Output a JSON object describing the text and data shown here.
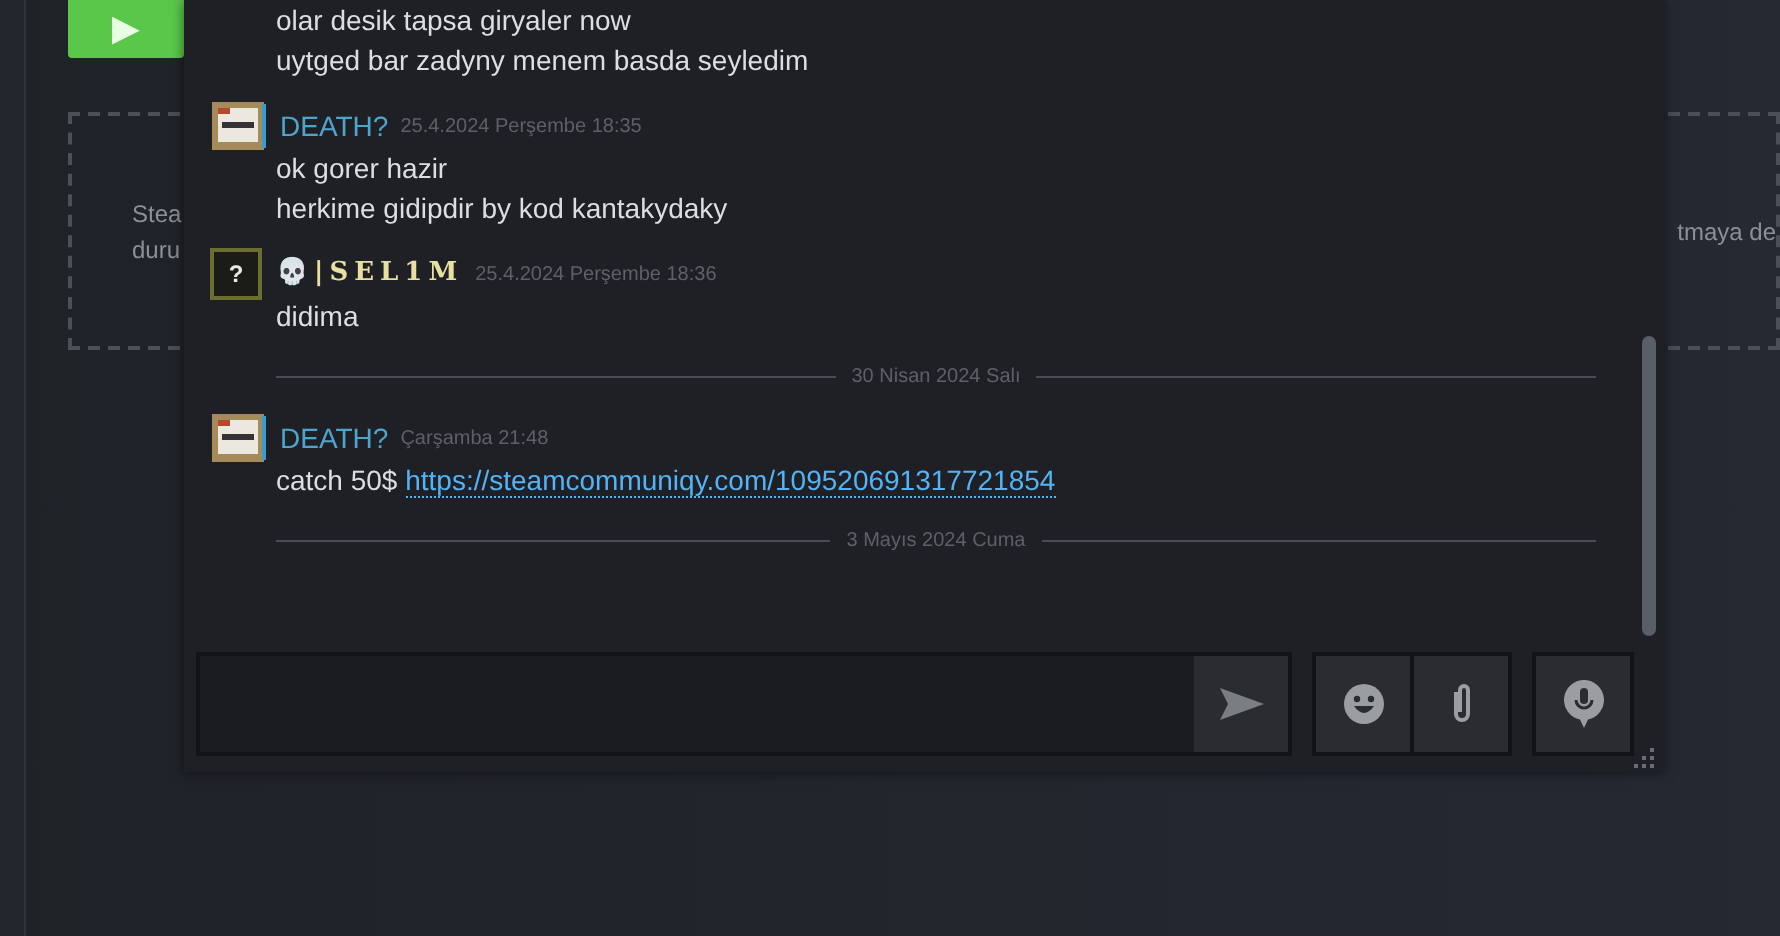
{
  "background": {
    "play_button": {
      "label": "▶"
    },
    "notice": {
      "left_lines": [
        "Stea",
        "duru"
      ],
      "right_fragment": "tmaya de"
    }
  },
  "chat": {
    "items": [
      {
        "kind": "lines",
        "lines": [
          "olar desik tapsa giryaler now",
          "uytged bar zadyny menem basda seyledim"
        ]
      },
      {
        "kind": "message",
        "author": "DEATH?",
        "fancy_name": false,
        "time": "25.4.2024 Perşembe 18:35",
        "avatar": {
          "kind": "picture"
        },
        "lines": [
          "ok gorer hazir",
          "herkime gidipdir by kod kantakydaky"
        ]
      },
      {
        "kind": "message",
        "author": "💀|SEL1M",
        "fancy_name": true,
        "time": "25.4.2024 Perşembe 18:36",
        "avatar": {
          "kind": "text",
          "text": "?"
        },
        "lines": [
          "didima"
        ]
      },
      {
        "kind": "divider",
        "label": "30 Nisan 2024 Salı"
      },
      {
        "kind": "message",
        "author": "DEATH?",
        "fancy_name": false,
        "time": "Çarşamba 21:48",
        "avatar": {
          "kind": "picture"
        },
        "lines": [
          "catch 50$"
        ],
        "link": "https://steamcommuniqy.com/109520691317721854"
      },
      {
        "kind": "divider",
        "label": "3 Mayıs 2024 Cuma"
      }
    ]
  }
}
